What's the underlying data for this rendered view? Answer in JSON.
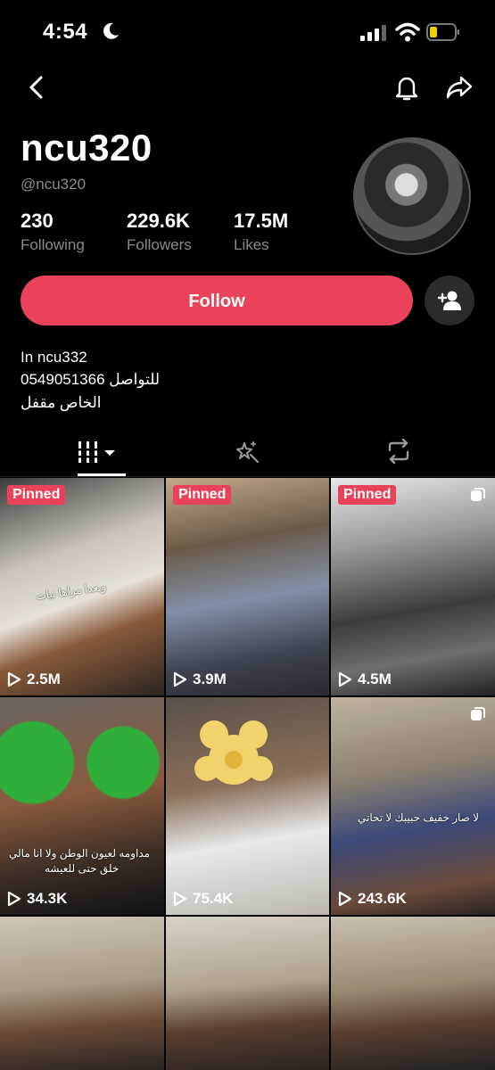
{
  "status_bar": {
    "time": "4:54",
    "icons": [
      "moon-icon",
      "signal-icon",
      "wifi-icon",
      "battery-icon"
    ]
  },
  "nav": {
    "icons": [
      "back-icon",
      "bell-icon",
      "share-icon"
    ]
  },
  "profile": {
    "display_name": "ncu320",
    "handle": "@ncu320",
    "stats": [
      {
        "value": "230",
        "label": "Following"
      },
      {
        "value": "229.6K",
        "label": "Followers"
      },
      {
        "value": "17.5M",
        "label": "Likes"
      }
    ],
    "follow_label": "Follow",
    "bio_lines": [
      "In ncu332",
      "0549051366 للتواصل",
      "الخاص مقفل"
    ]
  },
  "tabs": [
    "videos-grid-icon",
    "favorites-icon",
    "reposts-icon"
  ],
  "grid": {
    "tiles": [
      {
        "pinned": "Pinned",
        "views": "2.5M",
        "caption": "وبعدا مراها نيات"
      },
      {
        "pinned": "Pinned",
        "views": "3.9M"
      },
      {
        "pinned": "Pinned",
        "views": "4.5M"
      },
      {
        "views": "34.3K",
        "caption_lines": [
          "مداومه لعيون الوطن ولا انا مالي",
          "خلق حتى للعيشه"
        ]
      },
      {
        "views": "75.4K"
      },
      {
        "views": "243.6K",
        "caption": "لا صار خفيف حبيبك لا تحاتي"
      },
      {},
      {},
      {}
    ]
  },
  "colors": {
    "accent": "#ea4359",
    "background": "#000000",
    "muted_text": "#8a8a8a"
  }
}
